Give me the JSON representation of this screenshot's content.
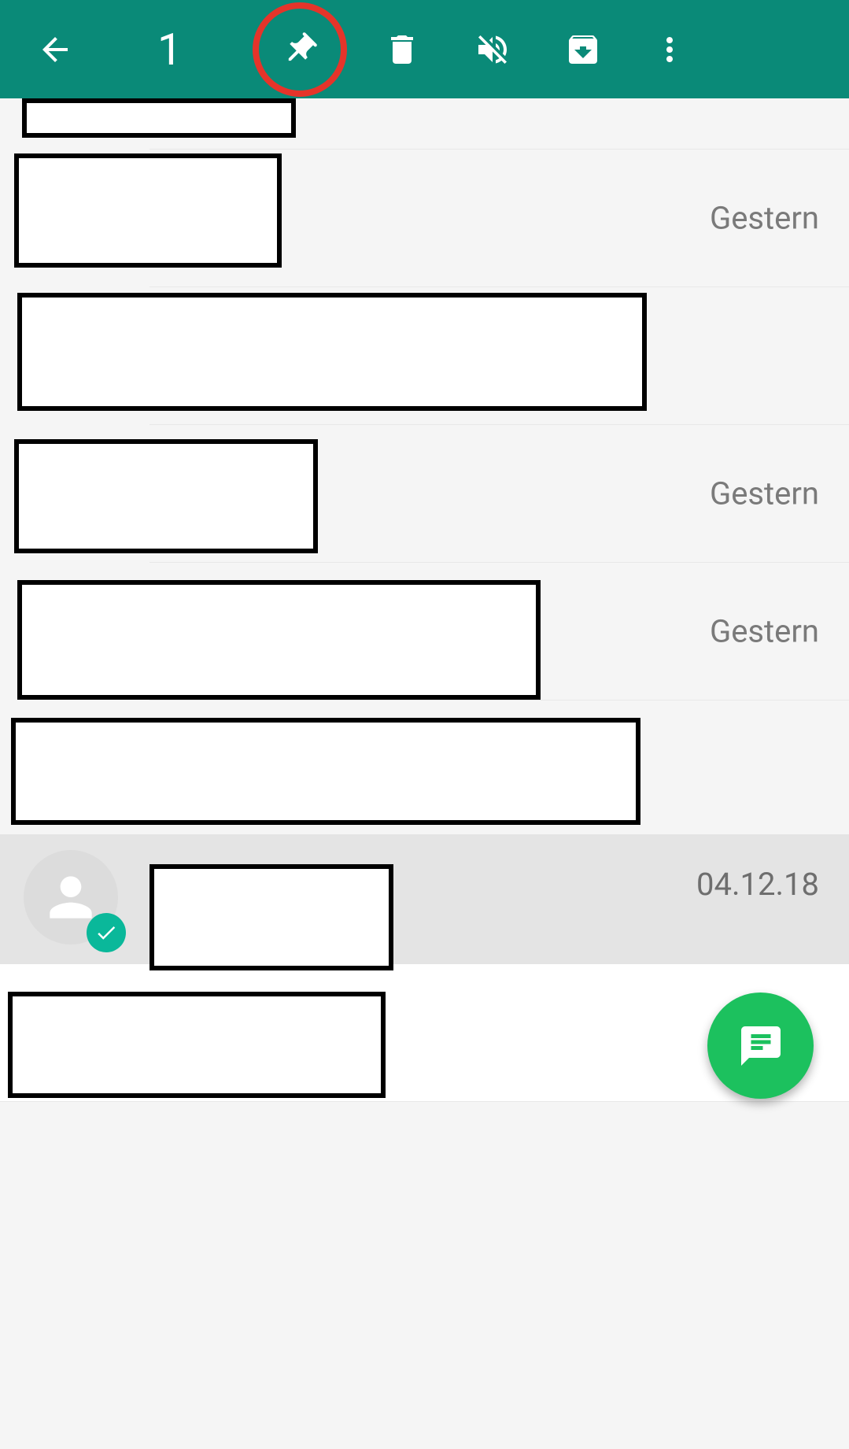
{
  "toolbar": {
    "selected_count": "1",
    "icons": {
      "back": "back-arrow-icon",
      "pin": "pin-icon",
      "delete": "trash-icon",
      "mute": "mute-icon",
      "archive": "archive-icon",
      "more": "more-vert-icon"
    }
  },
  "chats": [
    {
      "date": ""
    },
    {
      "date": "Gestern"
    },
    {
      "date": ""
    },
    {
      "date": "Gestern"
    },
    {
      "date": "Gestern"
    },
    {
      "date": ""
    },
    {
      "date": "04.12.18",
      "selected": true
    },
    {
      "date": ""
    }
  ],
  "fab": {
    "icon": "new-chat-icon"
  },
  "colors": {
    "toolbar": "#0a8a78",
    "fab": "#1cc15e",
    "highlight": "#e5342a",
    "badge": "#0ab89a",
    "selected_bg": "#e4e4e4",
    "text_muted": "#7a7a7a"
  }
}
